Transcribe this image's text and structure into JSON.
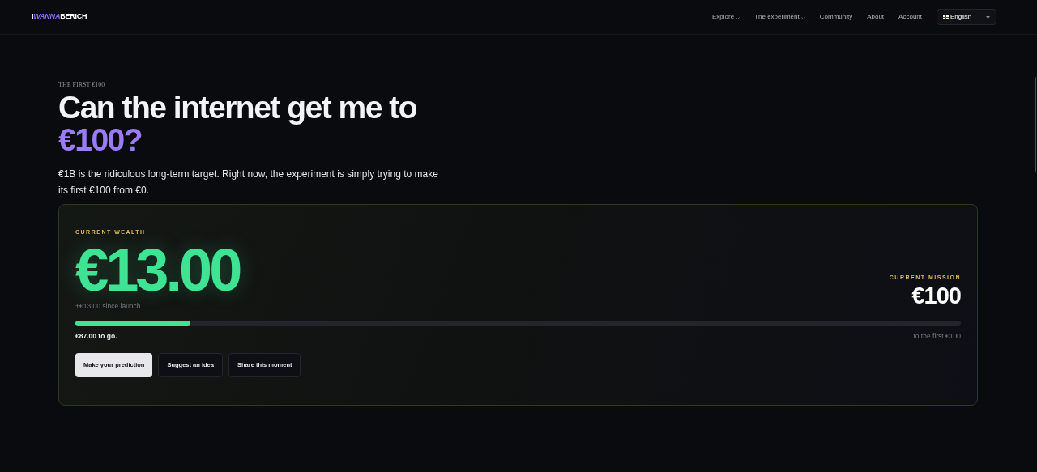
{
  "nav": {
    "logo": {
      "prefix": "I",
      "accent": "WANNA",
      "suffix": "BERICH"
    },
    "items": [
      {
        "label": "Explore",
        "has_menu": true
      },
      {
        "label": "The experiment",
        "has_menu": true
      },
      {
        "label": "Community",
        "has_menu": false
      },
      {
        "label": "About",
        "has_menu": false
      },
      {
        "label": "Account",
        "has_menu": false
      }
    ],
    "language": {
      "value": "English"
    }
  },
  "hero": {
    "eyebrow": "THE FIRST €100",
    "title": "Can the internet get me to",
    "title_highlight": "€100?",
    "intro": "€1B is the ridiculous long-term target. Right now, the experiment is simply trying to make its first €100 from €0."
  },
  "wealth_card": {
    "wealth_label": "CURRENT WEALTH",
    "wealth": "€13.00",
    "since": "+€13.00 since launch.",
    "mission_label": "CURRENT MISSION",
    "mission": "€100",
    "progress": {
      "level": 0.13
    },
    "to_go": "€87.00 to go.",
    "target_note": "to the first €100",
    "buttons": [
      {
        "label": "Make your prediction",
        "primary": true
      },
      {
        "label": "Suggest an idea",
        "primary": false
      },
      {
        "label": "Share this moment",
        "primary": false
      }
    ]
  }
}
